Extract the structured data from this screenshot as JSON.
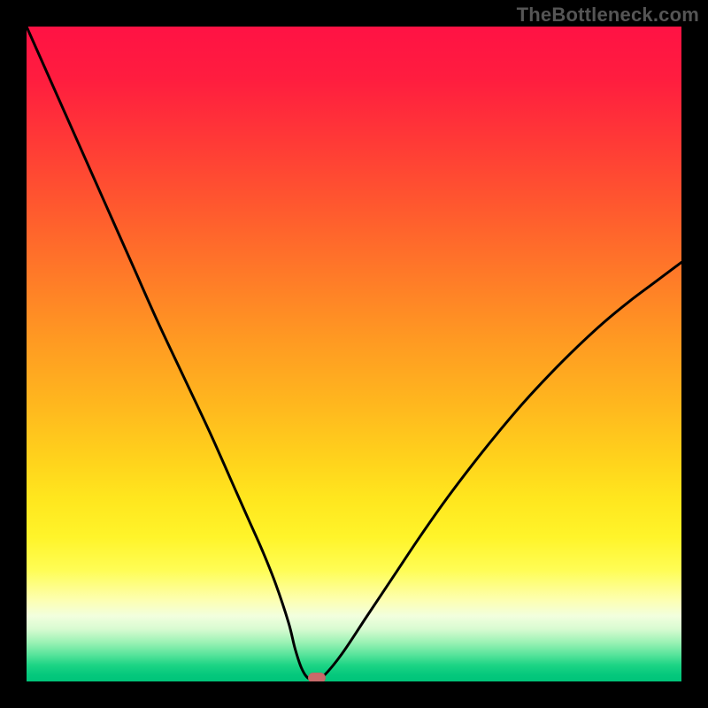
{
  "watermark": "TheBottleneck.com",
  "colors": {
    "curve_stroke": "#000000",
    "marker_fill": "#c86a6a",
    "frame_bg": "#000000"
  },
  "chart_data": {
    "type": "line",
    "title": "",
    "xlabel": "",
    "ylabel": "",
    "xlim": [
      0,
      100
    ],
    "ylim": [
      0,
      100
    ],
    "grid": false,
    "legend": false,
    "series": [
      {
        "name": "bottleneck-curve",
        "x": [
          0,
          4,
          8,
          12,
          16,
          20,
          24,
          28,
          32,
          34,
          36,
          38,
          40,
          41,
          42,
          43,
          44,
          45,
          48,
          52,
          56,
          60,
          64,
          68,
          72,
          76,
          80,
          84,
          88,
          92,
          96,
          100
        ],
        "y": [
          100,
          91,
          82,
          73,
          64,
          55,
          46.5,
          38,
          29,
          24.5,
          20,
          15,
          9,
          5,
          2,
          0.5,
          0.5,
          0.5,
          4,
          10,
          16,
          22,
          27.7,
          33,
          38,
          42.7,
          47,
          51,
          54.7,
          58,
          61,
          64
        ]
      }
    ],
    "annotations": [
      {
        "name": "optimal-marker",
        "x": 44.3,
        "y": 0.6
      }
    ],
    "background_gradient_stops": [
      {
        "pos": 0.0,
        "color": "#ff1244"
      },
      {
        "pos": 0.5,
        "color": "#ffb01f"
      },
      {
        "pos": 0.8,
        "color": "#fff84a"
      },
      {
        "pos": 0.92,
        "color": "#d8fbd1"
      },
      {
        "pos": 1.0,
        "color": "#00c47a"
      }
    ]
  }
}
